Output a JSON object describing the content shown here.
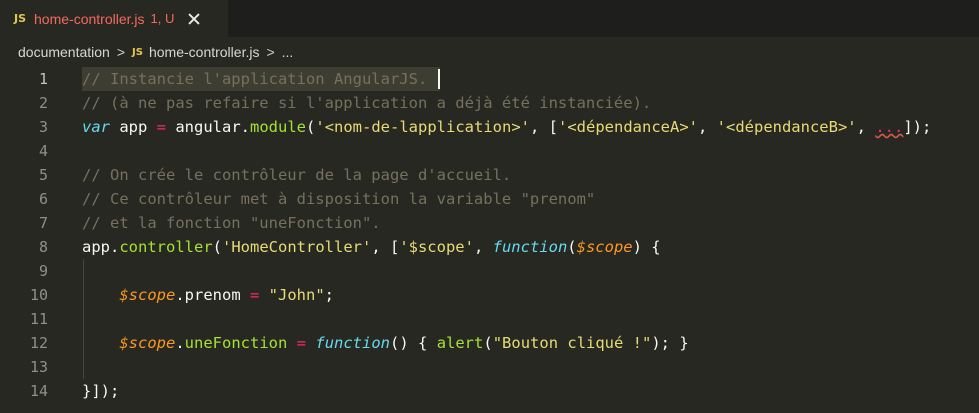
{
  "tab": {
    "badge": "JS",
    "title": "home-controller.js",
    "status": "1, U"
  },
  "breadcrumb": {
    "folder": "documentation",
    "badge": "JS",
    "file": "home-controller.js",
    "ellipsis": "...",
    "separator": ">"
  },
  "editor": {
    "active_line": 1,
    "line_numbers": [
      "1",
      "2",
      "3",
      "4",
      "5",
      "6",
      "7",
      "8",
      "9",
      "10",
      "11",
      "12",
      "13",
      "14"
    ],
    "lines": [
      [
        {
          "t": "// Instancie l'application AngularJS.",
          "k": "c"
        }
      ],
      [
        {
          "t": "// (à ne pas refaire si l'application a déjà été instanciée).",
          "k": "c"
        }
      ],
      [
        {
          "t": "var",
          "k": "kw"
        },
        {
          "t": " app ",
          "k": "pl"
        },
        {
          "t": "=",
          "k": "op"
        },
        {
          "t": " angular.",
          "k": "pl"
        },
        {
          "t": "module",
          "k": "fn"
        },
        {
          "t": "(",
          "k": "pl"
        },
        {
          "t": "'<nom-de-lapplication>'",
          "k": "s"
        },
        {
          "t": ", [",
          "k": "pl"
        },
        {
          "t": "'<dépendanceA>'",
          "k": "s"
        },
        {
          "t": ", ",
          "k": "pl"
        },
        {
          "t": "'<dépendanceB>'",
          "k": "s"
        },
        {
          "t": ", ",
          "k": "pl"
        },
        {
          "t": "...",
          "k": "dots"
        },
        {
          "t": "]);",
          "k": "pl"
        }
      ],
      [],
      [
        {
          "t": "// On crée le contrôleur de la page d'accueil.",
          "k": "c"
        }
      ],
      [
        {
          "t": "// Ce contrôleur met à disposition la variable \"prenom\"",
          "k": "c"
        }
      ],
      [
        {
          "t": "// et la fonction \"uneFonction\".",
          "k": "c"
        }
      ],
      [
        {
          "t": "app.",
          "k": "pl"
        },
        {
          "t": "controller",
          "k": "fn"
        },
        {
          "t": "(",
          "k": "pl"
        },
        {
          "t": "'HomeController'",
          "k": "s"
        },
        {
          "t": ", [",
          "k": "pl"
        },
        {
          "t": "'$scope'",
          "k": "s"
        },
        {
          "t": ", ",
          "k": "pl"
        },
        {
          "t": "function",
          "k": "kw"
        },
        {
          "t": "(",
          "k": "pl"
        },
        {
          "t": "$scope",
          "k": "p"
        },
        {
          "t": ") {",
          "k": "pl"
        }
      ],
      [],
      [
        {
          "t": "    ",
          "k": "pl"
        },
        {
          "t": "$scope",
          "k": "p"
        },
        {
          "t": ".prenom ",
          "k": "pl"
        },
        {
          "t": "=",
          "k": "op"
        },
        {
          "t": " ",
          "k": "pl"
        },
        {
          "t": "\"John\"",
          "k": "s"
        },
        {
          "t": ";",
          "k": "pl"
        }
      ],
      [],
      [
        {
          "t": "    ",
          "k": "pl"
        },
        {
          "t": "$scope",
          "k": "p"
        },
        {
          "t": ".",
          "k": "pl"
        },
        {
          "t": "uneFonction",
          "k": "fn"
        },
        {
          "t": " ",
          "k": "pl"
        },
        {
          "t": "=",
          "k": "op"
        },
        {
          "t": " ",
          "k": "pl"
        },
        {
          "t": "function",
          "k": "kw"
        },
        {
          "t": "() { ",
          "k": "pl"
        },
        {
          "t": "alert",
          "k": "fn"
        },
        {
          "t": "(",
          "k": "pl"
        },
        {
          "t": "\"Bouton cliqué !\"",
          "k": "s"
        },
        {
          "t": "); }",
          "k": "pl"
        }
      ],
      [],
      [
        {
          "t": "}]);",
          "k": "pl"
        }
      ]
    ]
  },
  "colors": {
    "background": "#272822",
    "tab_title": "#f36a5f",
    "js_badge": "#e6c84c",
    "comment": "#75715e",
    "keyword": "#66d9ef",
    "string": "#e6db74",
    "function": "#a6e22e",
    "parameter": "#fd971f",
    "operator": "#f92672"
  },
  "icons": {
    "tab_close": "close-icon",
    "file_type": "js-file-icon",
    "breadcrumb_separator": "chevron-right-icon"
  }
}
